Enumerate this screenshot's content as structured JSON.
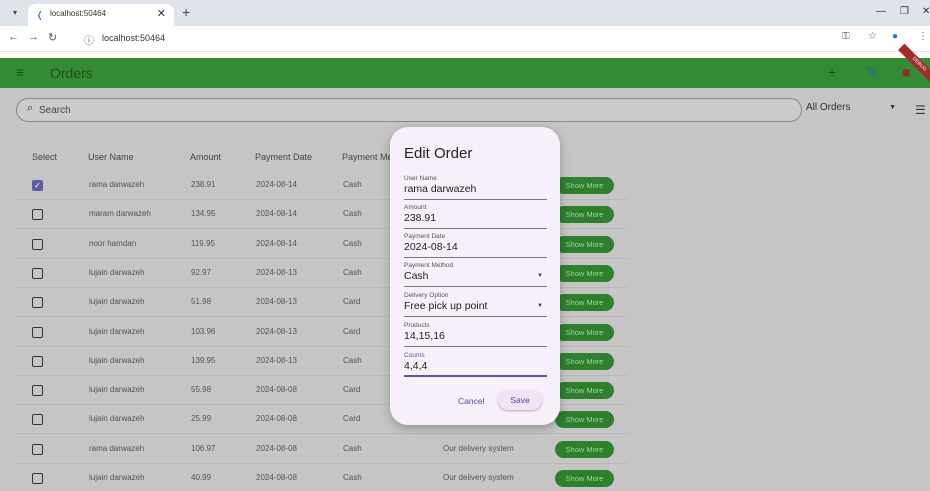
{
  "browser": {
    "tab_title": "localhost:50464",
    "tab_close": "✕",
    "new_tab": "+",
    "url": "localhost:50464"
  },
  "app": {
    "title": "Orders",
    "debug_label": "DEBUG"
  },
  "search": {
    "placeholder": "Search"
  },
  "filter": {
    "selected": "All Orders"
  },
  "table": {
    "columns": [
      "Select",
      "User Name",
      "Amount",
      "Payment Date",
      "Payment Me"
    ],
    "show_more_label": "Show More",
    "rows": [
      {
        "checked": true,
        "user": "rama darwazeh",
        "amount": "238.91",
        "date": "2024-08-14",
        "method": "Cash",
        "delivery": ""
      },
      {
        "checked": false,
        "user": "maram darwazeh",
        "amount": "134.95",
        "date": "2024-08-14",
        "method": "Cash",
        "delivery": ""
      },
      {
        "checked": false,
        "user": "noor hamdan",
        "amount": "119.95",
        "date": "2024-08-14",
        "method": "Cash",
        "delivery": ""
      },
      {
        "checked": false,
        "user": "lujain darwazeh",
        "amount": "92.97",
        "date": "2024-08-13",
        "method": "Cash",
        "delivery": ""
      },
      {
        "checked": false,
        "user": "lujain darwazeh",
        "amount": "51.98",
        "date": "2024-08-13",
        "method": "Card",
        "delivery": ""
      },
      {
        "checked": false,
        "user": "lujain darwazeh",
        "amount": "103.96",
        "date": "2024-08-13",
        "method": "Card",
        "delivery": ""
      },
      {
        "checked": false,
        "user": "lujain darwazeh",
        "amount": "139.95",
        "date": "2024-08-13",
        "method": "Cash",
        "delivery": ""
      },
      {
        "checked": false,
        "user": "lujain darwazeh",
        "amount": "55.98",
        "date": "2024-08-08",
        "method": "Card",
        "delivery": ""
      },
      {
        "checked": false,
        "user": "lujain darwazeh",
        "amount": "25.99",
        "date": "2024-08-08",
        "method": "Card",
        "delivery": ""
      },
      {
        "checked": false,
        "user": "rama darwazeh",
        "amount": "106.97",
        "date": "2024-08-08",
        "method": "Cash",
        "delivery": "Our delivery system"
      },
      {
        "checked": false,
        "user": "lujain darwazeh",
        "amount": "40.99",
        "date": "2024-08-08",
        "method": "Cash",
        "delivery": "Our delivery system"
      }
    ]
  },
  "dialog": {
    "title": "Edit Order",
    "fields": [
      {
        "label": "User Name",
        "value": "rama darwazeh",
        "dropdown": false
      },
      {
        "label": "Amount",
        "value": "238.91",
        "dropdown": false
      },
      {
        "label": "Payment Date",
        "value": "2024-08-14",
        "dropdown": false
      },
      {
        "label": "Payment Method",
        "value": "Cash",
        "dropdown": true
      },
      {
        "label": "Delivery Option",
        "value": "Free pick up point",
        "dropdown": true
      },
      {
        "label": "Products",
        "value": "14,15,16",
        "dropdown": false
      },
      {
        "label": "Counts",
        "value": "4,4,4",
        "dropdown": false
      }
    ],
    "cancel_label": "Cancel",
    "save_label": "Save"
  },
  "colors": {
    "appbar": "#358a34",
    "button": "#2e7f2e",
    "accent": "#6750a4",
    "overlay": "#c5c5c5"
  }
}
